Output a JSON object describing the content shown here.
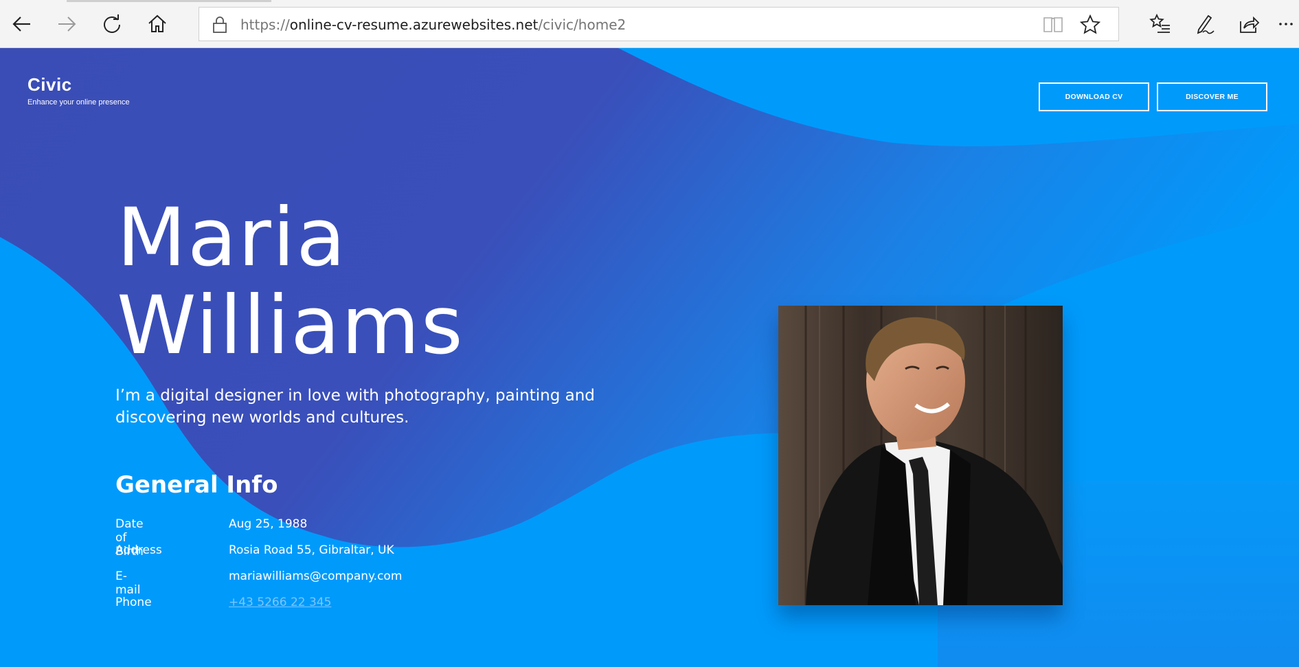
{
  "browser": {
    "url_scheme": "https://",
    "url_host": "online-cv-resume.azurewebsites.net",
    "url_path": "/civic/home2",
    "icons": [
      "back-icon",
      "forward-icon",
      "refresh-icon",
      "home-icon",
      "lock-icon",
      "reading-view-icon",
      "favorite-star-icon",
      "favorites-list-icon",
      "notes-pen-icon",
      "share-icon",
      "more-icon"
    ]
  },
  "header": {
    "brand": "Civic",
    "tagline": "Enhance your online presence",
    "download_cv": "DOWNLOAD CV",
    "discover_me": "DISCOVER ME"
  },
  "hero": {
    "first_name": "Maria",
    "last_name": "Williams",
    "intro": "I’m a digital designer in love with photography, painting and discovering new worlds and cultures."
  },
  "general_info": {
    "title": "General Info",
    "rows": [
      {
        "label": "Date of Birth",
        "value": "Aug 25, 1988"
      },
      {
        "label": "Address",
        "value": "Rosia Road 55, Gibraltar, UK"
      },
      {
        "label": "E-mail",
        "value": "mariawilliams@company.com"
      },
      {
        "label": "Phone",
        "value": "+43 5266 22 345"
      }
    ]
  },
  "colors": {
    "background_blue": "#009afb",
    "blob_indigo": "#3a4eb8",
    "text": "#ffffff",
    "phone_link": "#7cc6ff"
  }
}
